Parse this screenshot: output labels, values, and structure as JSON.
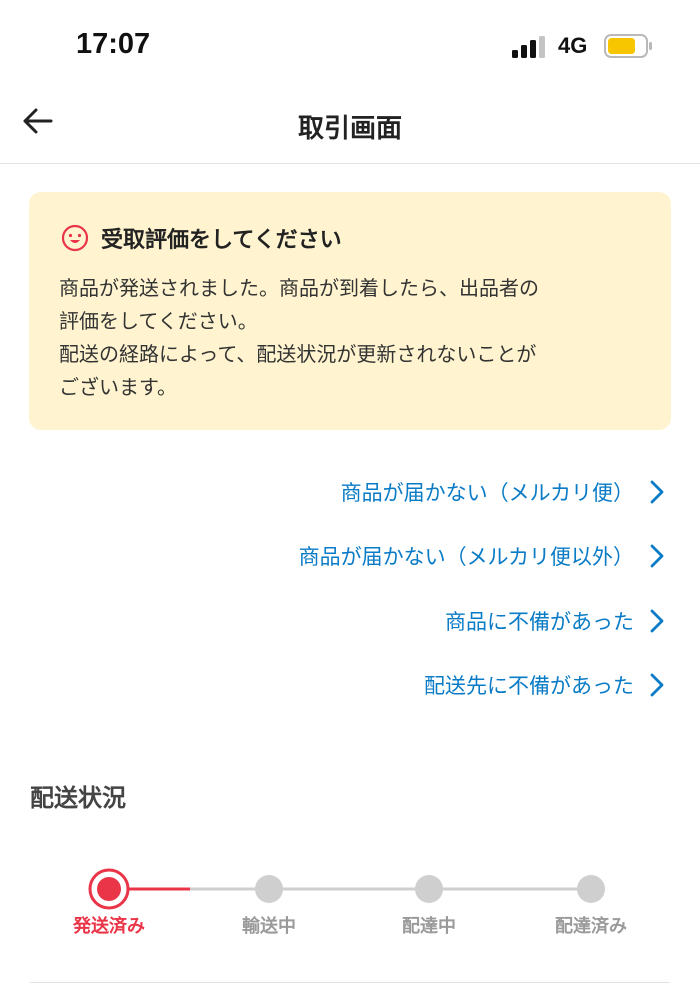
{
  "status_bar": {
    "time": "17:07",
    "network": "4G",
    "icons": [
      "signal-icon",
      "battery-icon"
    ]
  },
  "nav": {
    "title": "取引画面",
    "back_icon": "arrow-left-icon"
  },
  "notice": {
    "icon": "smile-face-icon",
    "title": "受取評価をしてください",
    "body_lines": [
      "商品が発送されました。商品が到着したら、出品者の",
      "評価をしてください。",
      "配送の経路によって、配送状況が更新されないことが",
      "ございます。"
    ]
  },
  "help_links": [
    {
      "label": "商品が届かない（メルカリ便）"
    },
    {
      "label": "商品が届かない（メルカリ便以外）"
    },
    {
      "label": "商品に不備があった"
    },
    {
      "label": "配送先に不備があった"
    }
  ],
  "shipping_status": {
    "title": "配送状況",
    "steps": [
      "発送済み",
      "輸送中",
      "配達中",
      "配達済み"
    ],
    "current_step": 0
  },
  "colors": {
    "accent_red": "#ea3447",
    "link_blue": "#0a7bc6",
    "notice_bg": "#fff4cf",
    "inactive_gray": "#cfcfcf",
    "battery_yellow": "#f7c600"
  }
}
